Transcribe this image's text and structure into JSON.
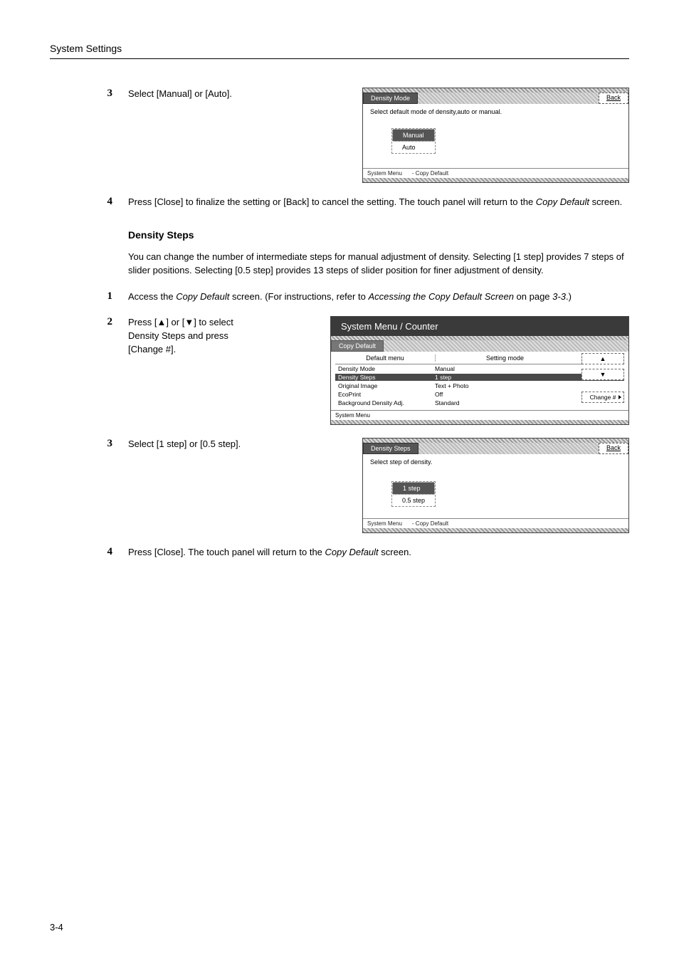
{
  "header": {
    "title": "System Settings"
  },
  "page_number": "3-4",
  "step3a": {
    "num": "3",
    "text": "Select [Manual] or [Auto]."
  },
  "panel_density_mode": {
    "title": "Density Mode",
    "back": "Back",
    "instr": "Select default mode of density,auto or manual.",
    "opt_manual": "Manual",
    "opt_auto": "Auto",
    "crumb1": "System Menu",
    "crumb2": "-  Copy Default"
  },
  "step4a": {
    "num": "4",
    "text_prefix": "Press [Close] to finalize the setting or [Back] to cancel the setting. The touch panel will return to the ",
    "text_em": "Copy Default",
    "text_suffix": " screen."
  },
  "heading_density_steps": "Density Steps",
  "density_desc": "You can change the number of intermediate steps for manual adjustment of density. Selecting [1 step] provides 7 steps of slider positions. Selecting [0.5 step] provides 13 steps of slider position for finer adjustment of density.",
  "step1b": {
    "num": "1",
    "prefix": "Access the ",
    "em1": "Copy Default",
    "mid": " screen. (For instructions, refer to ",
    "em2": "Accessing the Copy Default Screen",
    "suffix": " on page ",
    "em3": "3-3",
    "suffix2": ".)"
  },
  "step2b": {
    "num": "2",
    "prefix": "Press [▲] or [▼] to select ",
    "em": "Density Steps",
    "suffix": " and press [Change #]."
  },
  "panel_copy_default": {
    "title_sys": "System Menu / Counter",
    "subtitle": "Copy Default",
    "col1": "Default menu",
    "col2": "Setting mode",
    "rows": [
      {
        "c1": "Density Mode",
        "c2": "Manual",
        "hl": false
      },
      {
        "c1": "Density Steps",
        "c2": "1 step",
        "hl": true
      },
      {
        "c1": "Original Image",
        "c2": "Text + Photo",
        "hl": false
      },
      {
        "c1": "EcoPrint",
        "c2": "Off",
        "hl": false
      },
      {
        "c1": "Background Density Adj.",
        "c2": "Standard",
        "hl": false
      }
    ],
    "up": "▲",
    "down": "▼",
    "change": "Change #",
    "bottom": "System Menu"
  },
  "step3b": {
    "num": "3",
    "text": "Select [1 step] or [0.5 step]."
  },
  "panel_density_steps": {
    "title": "Density Steps",
    "back": "Back",
    "instr": "Select step of density.",
    "opt1": "1 step",
    "opt2": "0.5 step",
    "crumb1": "System Menu",
    "crumb2": "-  Copy Default"
  },
  "step4b": {
    "num": "4",
    "prefix": "Press [Close]. The touch panel will return to the ",
    "em": "Copy Default",
    "suffix": " screen."
  }
}
